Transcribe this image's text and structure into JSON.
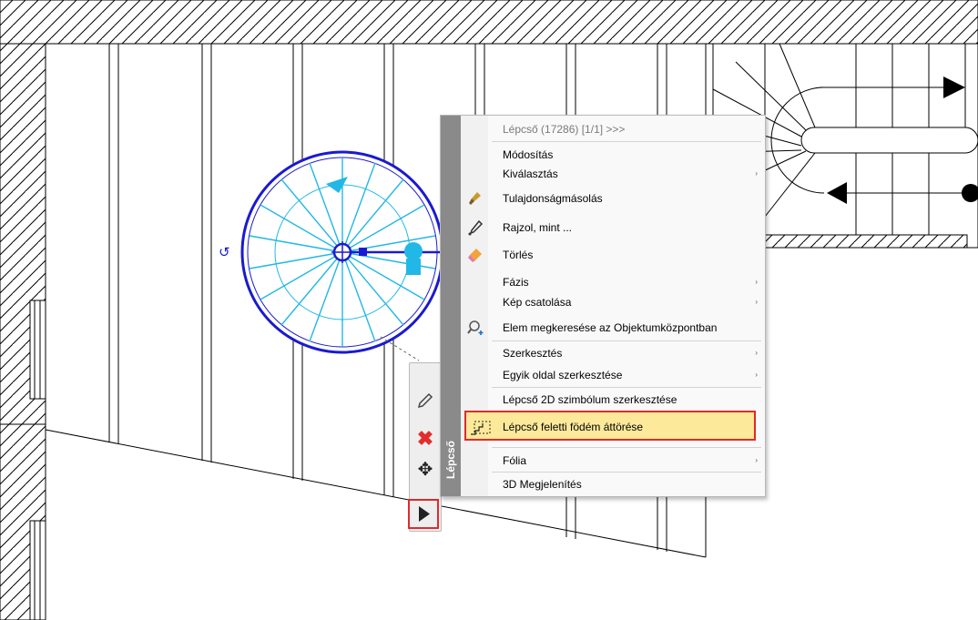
{
  "context_menu": {
    "header": "Lépcső (17286) [1/1] >>>",
    "side_label": "Lépcső",
    "items": [
      {
        "label": "Módosítás"
      },
      {
        "label": "Kiválasztás",
        "submenu": "›"
      },
      {
        "label": "Tulajdonságmásolás",
        "icon": "brush-icon"
      },
      {
        "label": "Rajzol, mint ...",
        "icon": "eyedropper-icon"
      },
      {
        "label": "Törlés",
        "icon": "eraser-icon"
      },
      {
        "label": "Fázis",
        "submenu": "›"
      },
      {
        "label": "Kép csatolása",
        "submenu": "›"
      },
      {
        "label": "Elem megkeresése az Objektumközpontban",
        "icon": "magnifier-plus-icon"
      },
      {
        "label": "Szerkesztés",
        "submenu": "›"
      },
      {
        "label": "Egyik oldal szerkesztése",
        "submenu": "›"
      },
      {
        "label": "Lépcső 2D szimbólum szerkesztése"
      },
      {
        "label": "Lépcső feletti födém áttörése",
        "icon": "slab-opening-icon",
        "highlighted": true
      },
      {
        "label": "Fólia",
        "submenu": "›"
      },
      {
        "label": "3D Megjelenítés"
      }
    ]
  },
  "quick_toolbar": {
    "buttons": [
      "edit-pencil-icon",
      "delete-x-icon",
      "move-arrows-icon",
      "expand-play-icon"
    ]
  },
  "colors": {
    "highlight_fill": "#fde99a",
    "highlight_border": "#e12a2a",
    "stair_blue": "#1a1ad0",
    "stair_cyan": "#22b8e6",
    "delete_red": "#e32d2d"
  }
}
